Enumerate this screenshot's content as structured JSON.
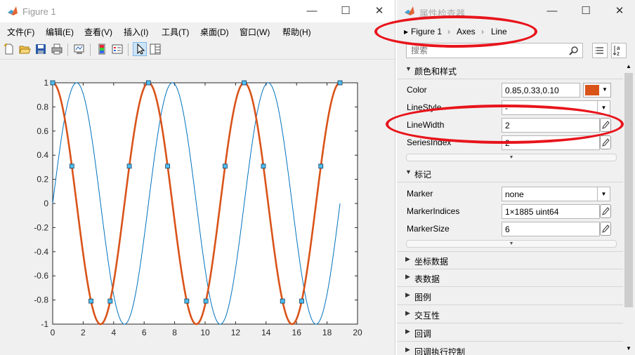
{
  "figure_window": {
    "title": "Figure 1",
    "menu": [
      "文件(F)",
      "编辑(E)",
      "查看(V)",
      "插入(I)",
      "工具(T)",
      "桌面(D)",
      "窗口(W)",
      "帮助(H)"
    ],
    "toolbar_icons": [
      "new-figure-icon",
      "open-file-icon",
      "save-icon",
      "print-icon",
      "link-plot-icon",
      "colorbar-icon",
      "legend-icon",
      "edit-plot-arrow-icon",
      "property-inspector-icon"
    ]
  },
  "chart_data": {
    "type": "line",
    "xlim": [
      0,
      20
    ],
    "ylim": [
      -1,
      1
    ],
    "xticks": [
      "0",
      "2",
      "4",
      "6",
      "8",
      "10",
      "12",
      "14",
      "16",
      "18",
      "20"
    ],
    "yticks": [
      "1",
      "0.8",
      "0.6",
      "0.4",
      "0.2",
      "0",
      "-0.2",
      "-0.4",
      "-0.6",
      "-0.8",
      "-1"
    ],
    "series": [
      {
        "function": "sin(x)",
        "x_range": [
          0,
          18.85
        ],
        "color": "#0072BD",
        "line_width": 0.5,
        "marker": "none"
      },
      {
        "function": "cos(x)",
        "x_range": [
          0,
          18.85
        ],
        "color": "#D95319",
        "line_width": 2,
        "marker": "square",
        "marker_face": "#4DBEEE",
        "marker_points": [
          [
            0,
            1
          ],
          [
            1.257,
            0.309
          ],
          [
            2.513,
            -0.809
          ],
          [
            3.77,
            -0.809
          ],
          [
            5.027,
            0.309
          ],
          [
            6.283,
            1
          ],
          [
            7.54,
            0.309
          ],
          [
            8.796,
            -0.809
          ],
          [
            10.053,
            -0.809
          ],
          [
            11.31,
            0.309
          ],
          [
            12.566,
            1
          ],
          [
            13.823,
            0.309
          ],
          [
            15.08,
            -0.809
          ],
          [
            16.336,
            -0.809
          ],
          [
            17.593,
            0.309
          ],
          [
            18.85,
            1
          ]
        ]
      }
    ]
  },
  "inspector": {
    "title": "属性检查器",
    "breadcrumb": [
      "Figure 1",
      "Axes",
      "Line"
    ],
    "search_placeholder": "搜索",
    "sections": {
      "color_style": "颜色和样式",
      "markers": "标记",
      "collapsed": [
        "坐标数据",
        "表数据",
        "图例",
        "交互性",
        "回调",
        "回调执行控制"
      ]
    },
    "props": {
      "color_label": "Color",
      "color_value": "0.85,0.33,0.10",
      "color_swatch": "#D95319",
      "linestyle_label": "LineStyle",
      "linestyle_value": "-",
      "linewidth_label": "LineWidth",
      "linewidth_value": "2",
      "seriesindex_label": "SeriesIndex",
      "seriesindex_value": "2",
      "marker_label": "Marker",
      "marker_value": "none",
      "markerindices_label": "MarkerIndices",
      "markerindices_value": "1×1885 uint64",
      "markersize_label": "MarkerSize",
      "markersize_value": "6"
    },
    "highlight_color": "#E8141B"
  }
}
